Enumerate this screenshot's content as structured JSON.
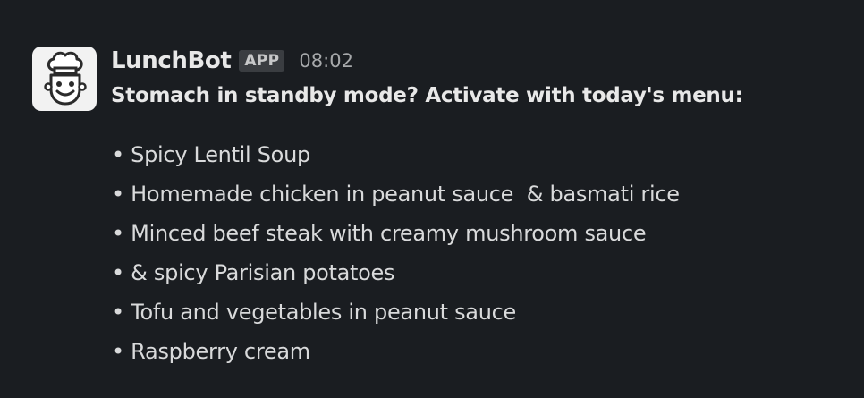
{
  "message": {
    "sender": "LunchBot",
    "badge": "APP",
    "time": "08:02",
    "headline": "Stomach in standby mode? Activate with today's menu:",
    "avatar_icon": "chef-face-icon",
    "items": [
      "• Spicy Lentil Soup",
      "• Homemade chicken in peanut sauce  & basmati rice",
      "• Minced beef steak with creamy mushroom sauce",
      "• & spicy Parisian potatoes",
      "• Tofu and vegetables in peanut sauce",
      "• Raspberry cream"
    ]
  }
}
